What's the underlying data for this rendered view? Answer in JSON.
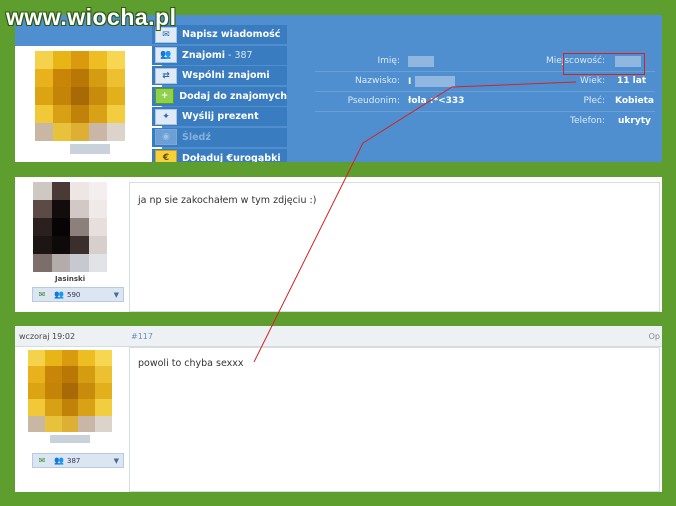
{
  "watermark": "www.wiocha.pl",
  "menu": {
    "items": [
      {
        "label": "Napisz wiadomość",
        "icon": "envelope-icon"
      },
      {
        "label": "Znajomi",
        "count": "- 387",
        "icon": "friends-icon"
      },
      {
        "label": "Wspólni znajomi",
        "icon": "mutual-friends-icon"
      },
      {
        "label": "Dodaj do znajomych",
        "icon": "add-friend-icon"
      },
      {
        "label": "Wyślij prezent",
        "icon": "gift-icon"
      },
      {
        "label": "Śledź",
        "icon": "eye-icon"
      },
      {
        "label": "Doładuj €urogąbki",
        "icon": "coins-icon"
      }
    ]
  },
  "profile_info": {
    "first_name_label": "Imię:",
    "last_name_label": "Nazwisko:",
    "last_name_value": "I",
    "nickname_label": "Pseudonim:",
    "nickname_value": "łola :*<333",
    "city_label": "Miejscowość:",
    "age_label": "Wiek:",
    "age_value": "11 lat",
    "gender_label": "Płeć:",
    "gender_value": "Kobieta",
    "phone_label": "Telefon:",
    "phone_value": "ukryty"
  },
  "posts": [
    {
      "text": "ja np sie zakochałem w tym zdjęciu :)",
      "author_name": "Jasinski",
      "friends_count": "590"
    },
    {
      "timestamp": "wczoraj 19:02",
      "number": "#117",
      "extra": "Op",
      "text": "powoli to chyba sexxx",
      "friends_count": "387"
    }
  ],
  "colors": {
    "background": "#5e9e2e",
    "panel_blue": "#4f8fcf",
    "annotation_red": "#d42222"
  }
}
